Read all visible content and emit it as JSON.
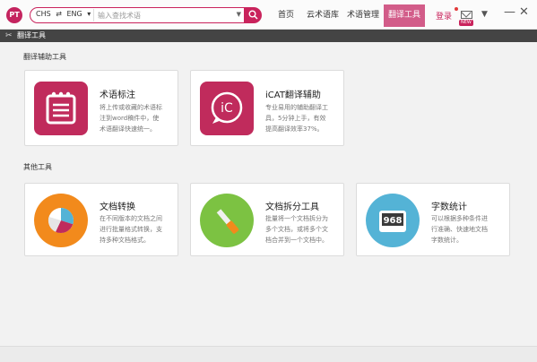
{
  "app": {
    "logo_text": "PT"
  },
  "search": {
    "source_lang": "CHS",
    "swap_symbol": "⇄",
    "target_lang": "ENG",
    "lang_dropdown": "▾",
    "placeholder": "输入查找术语"
  },
  "nav": {
    "items": [
      {
        "label": "首页"
      },
      {
        "label": "云术语库"
      },
      {
        "label": "术语管理"
      },
      {
        "label": "翻译工具"
      }
    ],
    "active_index": 3
  },
  "user": {
    "login_label": "登录",
    "new_badge": "NEW"
  },
  "section": {
    "title": "翻译工具"
  },
  "groups": {
    "assist": {
      "title": "翻译辅助工具",
      "cards": [
        {
          "name": "术语标注",
          "desc_lines": [
            "将上传或收藏的术语标",
            "注到word稿件中，使",
            "术语翻译快速统一。"
          ]
        },
        {
          "name": "iCAT翻译辅助",
          "icon_text": "iC",
          "desc_lines": [
            "专业易用的辅助翻译工",
            "具，5分钟上手，有效",
            "提高翻译效率37%。"
          ]
        }
      ]
    },
    "other": {
      "title": "其他工具",
      "cards": [
        {
          "name": "文档转换",
          "desc_lines": [
            "在不同版本的文档之间",
            "进行批量格式转换，支",
            "持多种文档格式。"
          ]
        },
        {
          "name": "文档拆分工具",
          "desc_lines": [
            "批量将一个文档拆分为",
            "多个文档，或将多个文",
            "档合并到一个文档中。"
          ]
        },
        {
          "name": "字数统计",
          "icon_text": "968",
          "desc_lines": [
            "可以根据多种条件进",
            "行准确、快速地文档",
            "字数统计。"
          ]
        }
      ]
    }
  },
  "colors": {
    "accent": "#c9235c",
    "nav_active": "#d25c89",
    "convert_orange": "#f28a1c",
    "split_green": "#7cc242",
    "count_blue": "#54b3d6"
  }
}
